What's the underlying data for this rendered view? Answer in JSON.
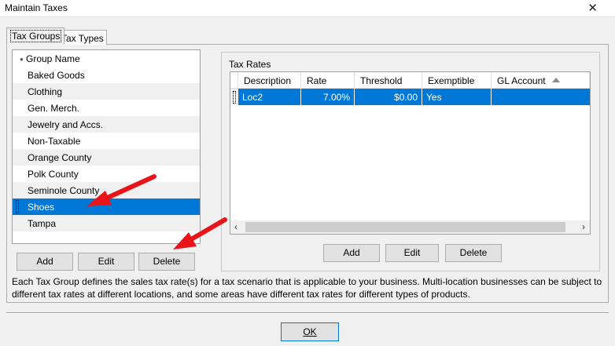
{
  "window": {
    "title": "Maintain Taxes",
    "close_glyph": "✕"
  },
  "tabs": [
    {
      "label": "Tax Groups",
      "active": true
    },
    {
      "label": "Tax Types",
      "active": false
    }
  ],
  "group_list": {
    "header": "Group Name",
    "items": [
      "Baked Goods",
      "Clothing",
      "Gen. Merch.",
      "Jewelry and Accs.",
      "Non-Taxable",
      "Orange County",
      "Polk County",
      "Seminole County",
      "Shoes",
      "Tampa"
    ],
    "selected": "Shoes"
  },
  "group_buttons": {
    "add": "Add",
    "edit": "Edit",
    "delete": "Delete"
  },
  "tax_rates": {
    "legend": "Tax Rates",
    "columns": [
      "Description",
      "Rate",
      "Threshold",
      "Exemptible",
      "GL Account"
    ],
    "rows": [
      {
        "description": "Loc2",
        "rate": "7.00%",
        "threshold": "$0.00",
        "exemptible": "Yes",
        "gl_account": ""
      }
    ],
    "sort_icon": "sort-ascending-icon"
  },
  "rates_buttons": {
    "add": "Add",
    "edit": "Edit",
    "delete": "Delete"
  },
  "description": "Each Tax Group defines the sales tax rate(s) for a tax scenario that is applicable to your business. Multi-location businesses can be subject to different tax rates at different locations, and some areas have different tax rates for different types of products.",
  "ok_button": "OK",
  "colors": {
    "selection": "#0078d7",
    "annotation_arrow": "#e8141a"
  }
}
